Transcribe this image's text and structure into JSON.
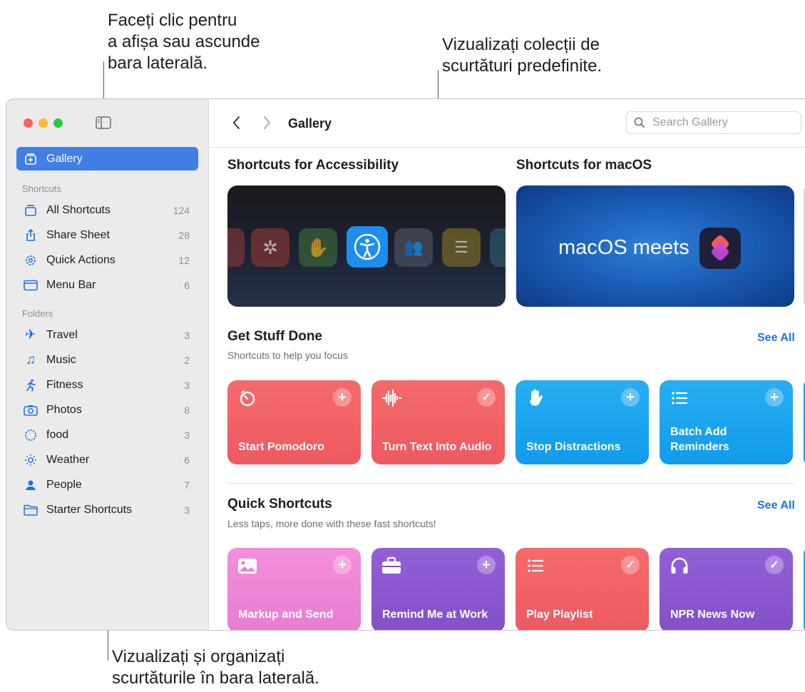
{
  "callouts": {
    "sidebar_toggle": "Faceți clic pentru\na afișa sau ascunde\nbara laterală.",
    "gallery_collections": "Vizualizați colecții de\nscurtături predefinite.",
    "sidebar_organize": "Vizualizați și organizați\nscurtăturile în bara laterală."
  },
  "colors": {
    "accent": "#3f7fe6",
    "link": "#1a73e8",
    "red": "#ef5d62",
    "blue": "#1ea4f0",
    "pink": "#ef85d4",
    "purple": "#8a55cf"
  },
  "sidebar": {
    "gallery": {
      "label": "Gallery",
      "icon": "gallery-icon"
    },
    "shortcuts_header": "Shortcuts",
    "shortcuts": [
      {
        "label": "All Shortcuts",
        "count": "124",
        "icon": "stack-icon"
      },
      {
        "label": "Share Sheet",
        "count": "28",
        "icon": "share-icon"
      },
      {
        "label": "Quick Actions",
        "count": "12",
        "icon": "gear-icon"
      },
      {
        "label": "Menu Bar",
        "count": "6",
        "icon": "menubar-icon"
      }
    ],
    "folders_header": "Folders",
    "folders": [
      {
        "label": "Travel",
        "count": "3",
        "icon": "airplane-icon"
      },
      {
        "label": "Music",
        "count": "2",
        "icon": "music-note-icon"
      },
      {
        "label": "Fitness",
        "count": "3",
        "icon": "running-figure-icon"
      },
      {
        "label": "Photos",
        "count": "8",
        "icon": "camera-icon"
      },
      {
        "label": "food",
        "count": "3",
        "icon": "dashed-circle-icon"
      },
      {
        "label": "Weather",
        "count": "6",
        "icon": "sun-icon"
      },
      {
        "label": "People",
        "count": "7",
        "icon": "person-icon"
      },
      {
        "label": "Starter Shortcuts",
        "count": "3",
        "icon": "folder-icon"
      }
    ]
  },
  "toolbar": {
    "title": "Gallery",
    "search_placeholder": "Search Gallery"
  },
  "banners": {
    "accessibility_title": "Shortcuts for Accessibility",
    "macos_title": "Shortcuts for macOS",
    "macos_text": "macOS meets"
  },
  "get_stuff_done": {
    "title": "Get Stuff Done",
    "subtitle": "Shortcuts to help you focus",
    "see_all": "See All",
    "tiles": [
      {
        "label": "Start Pomodoro",
        "action": "+",
        "icon": "timer-icon"
      },
      {
        "label": "Turn Text Into Audio",
        "action": "✓",
        "icon": "waveform-icon"
      },
      {
        "label": "Stop Distractions",
        "action": "+",
        "icon": "hand-icon"
      },
      {
        "label": "Batch Add Reminders",
        "action": "+",
        "icon": "list-icon"
      }
    ]
  },
  "quick_shortcuts": {
    "title": "Quick Shortcuts",
    "subtitle": "Less taps, more done with these fast shortcuts!",
    "see_all": "See All",
    "tiles": [
      {
        "label": "Markup and Send",
        "action": "+",
        "icon": "photo-icon"
      },
      {
        "label": "Remind Me at Work",
        "action": "+",
        "icon": "briefcase-icon"
      },
      {
        "label": "Play Playlist",
        "action": "✓",
        "icon": "list-icon"
      },
      {
        "label": "NPR News Now",
        "action": "✓",
        "icon": "headphones-icon"
      }
    ]
  }
}
